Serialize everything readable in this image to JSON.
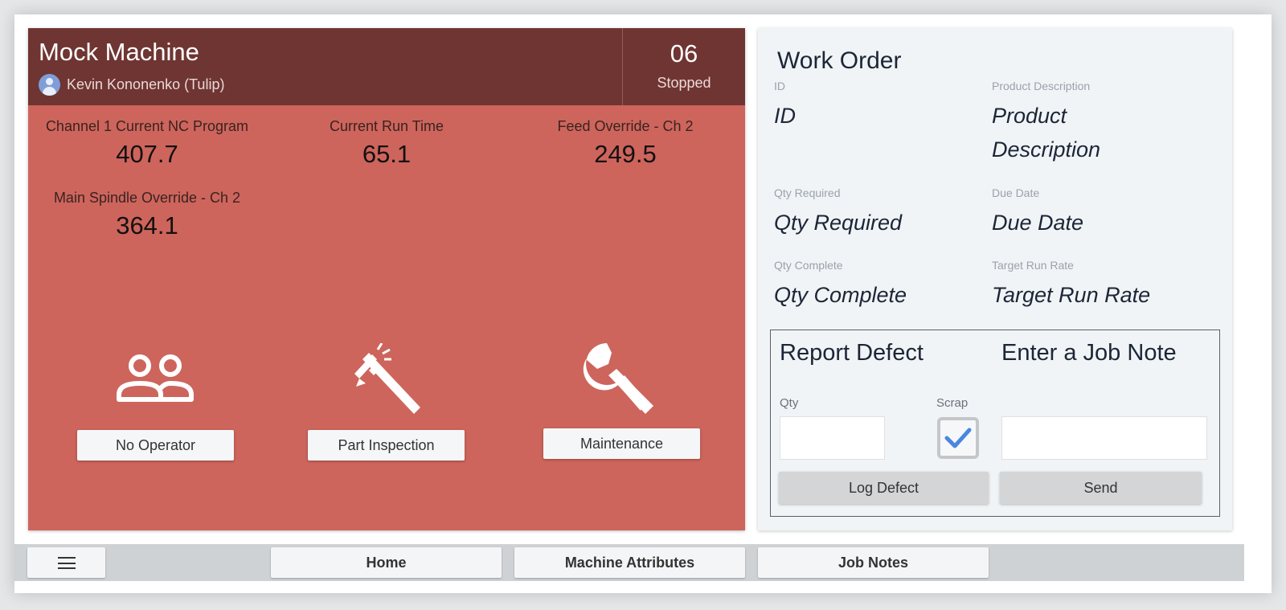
{
  "machine": {
    "title": "Mock Machine",
    "user": "Kevin Kononenko (Tulip)",
    "status_number": "06",
    "status_text": "Stopped",
    "metrics": [
      {
        "label": "Channel 1 Current NC Program",
        "value": "407.7"
      },
      {
        "label": "Current Run Time",
        "value": "65.1"
      },
      {
        "label": "Feed Override - Ch 2",
        "value": "249.5"
      },
      {
        "label": "Main Spindle Override - Ch 2",
        "value": "364.1"
      }
    ],
    "actions": [
      {
        "label": "No Operator",
        "icon": "people-icon"
      },
      {
        "label": "Part Inspection",
        "icon": "caliper-icon"
      },
      {
        "label": "Maintenance",
        "icon": "wrench-icon"
      }
    ],
    "panel_color": "#cd655c",
    "header_color": "#6f3532"
  },
  "work_order": {
    "title": "Work Order",
    "fields": [
      {
        "label": "ID",
        "value": "ID"
      },
      {
        "label": "Product Description",
        "value": "Product Description"
      },
      {
        "label": "Qty Required",
        "value": "Qty Required"
      },
      {
        "label": "Due Date",
        "value": "Due Date"
      },
      {
        "label": "Qty Complete",
        "value": "Qty Complete"
      },
      {
        "label": "Target Run Rate",
        "value": "Target Run Rate"
      }
    ]
  },
  "defect": {
    "title": "Report Defect",
    "qty_label": "Qty",
    "qty_value": "",
    "scrap_label": "Scrap",
    "scrap_checked": true,
    "log_button": "Log Defect"
  },
  "job_note": {
    "title": "Enter a Job Note",
    "note_value": "",
    "send_button": "Send"
  },
  "nav": {
    "menu_icon": "hamburger-menu-icon",
    "tabs": [
      "Home",
      "Machine Attributes",
      "Job Notes"
    ]
  }
}
